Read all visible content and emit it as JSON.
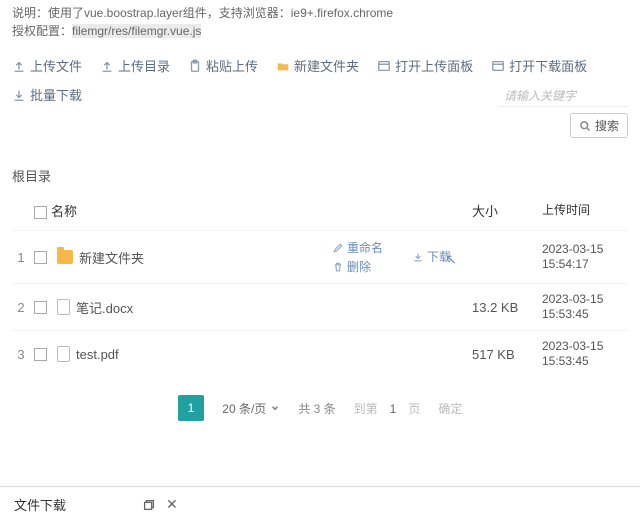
{
  "meta": {
    "line1": "说明：使用了vue.boostrap.layer组件，支持浏览器：ie9+.firefox.chrome",
    "line2a": "授权配置：",
    "line2b": "filemgr/res/filemgr.vue.js"
  },
  "toolbar": {
    "upload": "上传文件",
    "updir": "上传目录",
    "paste": "粘贴上传",
    "newfolder": "新建文件夹",
    "openUp": "打开上传面板",
    "openDown": "打开下载面板",
    "batchDown": "批量下载"
  },
  "search": {
    "placeholder": "请输入关键字",
    "btn": "搜索"
  },
  "crumb": "根目录",
  "columns": {
    "name": "名称",
    "size": "大小",
    "time": "上传时间"
  },
  "ops": {
    "rename": "重命名",
    "del": "删除",
    "download": "下载"
  },
  "rows": [
    {
      "idx": "1",
      "type": "folder",
      "name": "新建文件夹",
      "size": "",
      "t1": "2023-03-15",
      "t2": "15:54:17",
      "active": true
    },
    {
      "idx": "2",
      "type": "file",
      "name": "笔记.docx",
      "size": "13.2 KB",
      "t1": "2023-03-15",
      "t2": "15:53:45",
      "active": false
    },
    {
      "idx": "3",
      "type": "file",
      "name": "test.pdf",
      "size": "517 KB",
      "t1": "2023-03-15",
      "t2": "15:53:45",
      "active": false
    }
  ],
  "pager": {
    "current": "1",
    "pageSize": "20 条/页",
    "total": "共 3 条",
    "jump": "到第",
    "page": "1",
    "pageSuffix": "页",
    "go": "确定"
  },
  "bottom": {
    "title": "文件下载"
  }
}
